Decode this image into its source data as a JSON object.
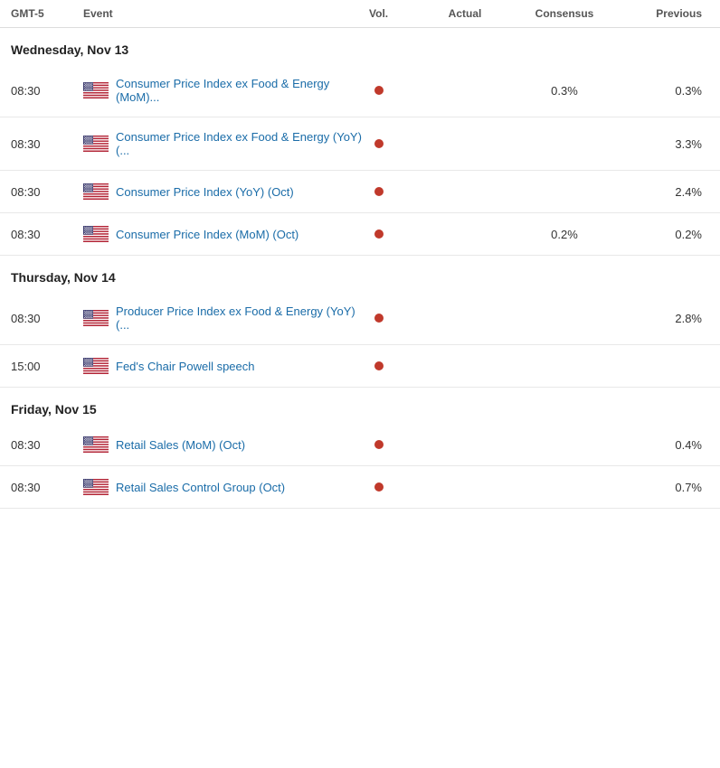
{
  "header": {
    "gmt_label": "GMT-5",
    "event_label": "Event",
    "vol_label": "Vol.",
    "actual_label": "Actual",
    "consensus_label": "Consensus",
    "previous_label": "Previous"
  },
  "sections": [
    {
      "title": "Wednesday, Nov 13",
      "events": [
        {
          "time": "08:30",
          "country": "US",
          "name": "Consumer Price Index ex Food & Energy (MoM)...",
          "has_vol": true,
          "actual": "",
          "consensus": "0.3%",
          "previous": "0.3%"
        },
        {
          "time": "08:30",
          "country": "US",
          "name": "Consumer Price Index ex Food & Energy (YoY) (...",
          "has_vol": true,
          "actual": "",
          "consensus": "",
          "previous": "3.3%"
        },
        {
          "time": "08:30",
          "country": "US",
          "name": "Consumer Price Index (YoY) (Oct)",
          "has_vol": true,
          "actual": "",
          "consensus": "",
          "previous": "2.4%"
        },
        {
          "time": "08:30",
          "country": "US",
          "name": "Consumer Price Index (MoM) (Oct)",
          "has_vol": true,
          "actual": "",
          "consensus": "0.2%",
          "previous": "0.2%"
        }
      ]
    },
    {
      "title": "Thursday, Nov 14",
      "events": [
        {
          "time": "08:30",
          "country": "US",
          "name": "Producer Price Index ex Food & Energy (YoY) (...",
          "has_vol": true,
          "actual": "",
          "consensus": "",
          "previous": "2.8%"
        },
        {
          "time": "15:00",
          "country": "US",
          "name": "Fed's Chair Powell speech",
          "has_vol": true,
          "actual": "",
          "consensus": "",
          "previous": ""
        }
      ]
    },
    {
      "title": "Friday, Nov 15",
      "events": [
        {
          "time": "08:30",
          "country": "US",
          "name": "Retail Sales (MoM) (Oct)",
          "has_vol": true,
          "actual": "",
          "consensus": "",
          "previous": "0.4%"
        },
        {
          "time": "08:30",
          "country": "US",
          "name": "Retail Sales Control Group (Oct)",
          "has_vol": true,
          "actual": "",
          "consensus": "",
          "previous": "0.7%"
        }
      ]
    }
  ]
}
